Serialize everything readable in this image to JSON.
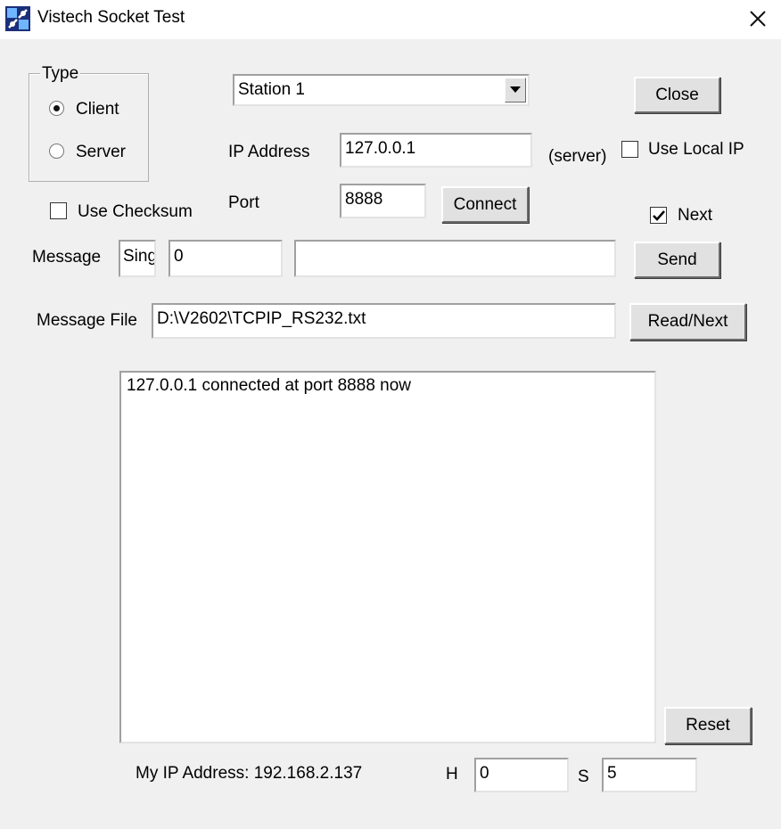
{
  "window": {
    "title": "Vistech Socket Test",
    "icon": "app-icon"
  },
  "type_group": {
    "label": "Type",
    "options": [
      {
        "label": "Client",
        "selected": true
      },
      {
        "label": "Server",
        "selected": false
      }
    ]
  },
  "station": {
    "selected": "Station 1"
  },
  "close_button": "Close",
  "ip_address": {
    "label": "IP Address",
    "value": "127.0.0.1",
    "suffix": "(server)"
  },
  "use_local_ip": {
    "label": "Use Local IP",
    "checked": false
  },
  "use_checksum": {
    "label": "Use Checksum",
    "checked": false
  },
  "port": {
    "label": "Port",
    "value": "8888"
  },
  "connect_button": "Connect",
  "next": {
    "label": "Next",
    "checked": true
  },
  "message": {
    "label": "Message",
    "prefix": "Sing",
    "count": "0",
    "text": ""
  },
  "send_button": "Send",
  "message_file": {
    "label": "Message File",
    "value": "D:\\V2602\\TCPIP_RS232.txt"
  },
  "read_next_button": "Read/Next",
  "log": {
    "lines": [
      "127.0.0.1 connected at port 8888 now"
    ]
  },
  "reset_button": "Reset",
  "footer": {
    "my_ip": "My IP Address: 192.168.2.137",
    "h_label": "H",
    "h_value": "0",
    "s_label": "S",
    "s_value": "5"
  }
}
